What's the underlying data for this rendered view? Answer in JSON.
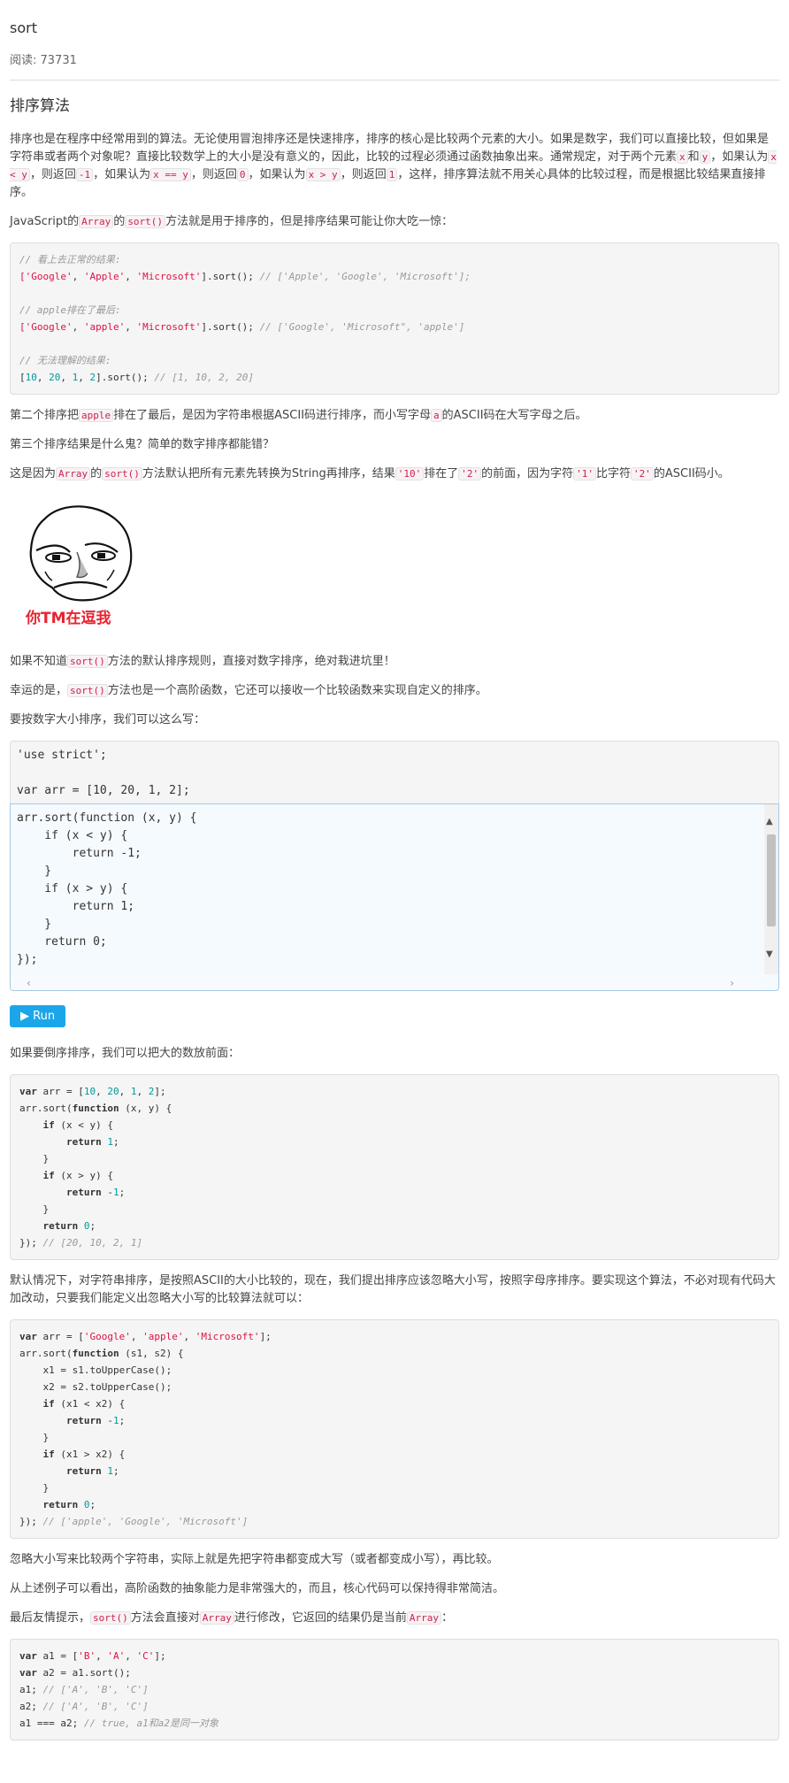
{
  "header": {
    "title": "sort",
    "reads_label": "阅读: 73731"
  },
  "article": {
    "heading": "排序算法",
    "intro_para": [
      "排序也是在程序中经常用到的算法。无论使用冒泡排序还是快速排序，排序的核心是比较两个元素的大小。如果是数字，我们可以直接比较，但如果是字符串或者两个对象呢？直接比较数学上的大小是没有意义的，因此，比较的过程必须通过函数抽象出来。通常规定，对于两个元素",
      "x",
      "和",
      "y",
      "，如果认为",
      "x < y",
      "，则返回",
      "-1",
      "，如果认为",
      "x == y",
      "，则返回",
      "0",
      "，如果认为",
      "x > y",
      "，则返回",
      "1",
      "，这样，排序算法就不用关心具体的比较过程，而是根据比较结果直接排序。"
    ],
    "js_para": [
      "JavaScript的",
      "Array",
      "的",
      "sort()",
      "方法就是用于排序的，但是排序结果可能让你大吃一惊："
    ],
    "code1": {
      "c1": "// 看上去正常的结果:",
      "l1a": "['Google'",
      "l1b": "'Apple'",
      "l1c": "'Microsoft'",
      "l1d": "].sort(); ",
      "l1e": "// ['Apple', 'Google', 'Microsoft'];",
      "c2": "// apple排在了最后:",
      "l2a": "['Google'",
      "l2b": "'apple'",
      "l2c": "'Microsoft'",
      "l2d": "].sort(); ",
      "l2e": "// ['Google', 'Microsoft\", 'apple']",
      "c3": "// 无法理解的结果:",
      "n1": "10",
      "n2": "20",
      "n3": "1",
      "n4": "2",
      "l3e": "// [1, 10, 2, 20]"
    },
    "p_second": [
      "第二个排序把",
      "apple",
      "排在了最后，是因为字符串根据ASCII码进行排序，而小写字母",
      "a",
      "的ASCII码在大写字母之后。"
    ],
    "p_third": "第三个排序结果是什么鬼？简单的数字排序都能错？",
    "p_because": [
      "这是因为",
      "Array",
      "的",
      "sort()",
      "方法默认把所有元素先转换为String再排序，结果",
      "'10'",
      "排在了",
      "'2'",
      "的前面，因为字符",
      "'1'",
      "比字符",
      "'2'",
      "的ASCII码小。"
    ],
    "meme_caption": "你TM在逗我",
    "p_if_not": [
      "如果不知道",
      "sort()",
      "方法的默认排序规则，直接对数字排序，绝对栽进坑里！"
    ],
    "p_luckily": [
      "幸运的是，",
      "sort()",
      "方法也是一个高阶函数，它还可以接收一个比较函数来实现自定义的排序。"
    ],
    "p_to_sort": "要按数字大小排序，我们可以这么写：",
    "static_code": "'use strict';\n\nvar arr = [10, 20, 1, 2];",
    "editor_code": "arr.sort(function (x, y) {\n    if (x < y) {\n        return -1;\n    }\n    if (x > y) {\n        return 1;\n    }\n    return 0;\n});",
    "run_label": "▶ Run",
    "p_reverse": "如果要倒序排序，我们可以把大的数放前面：",
    "p_default_case": "默认情况下，对字符串排序，是按照ASCII的大小比较的，现在，我们提出排序应该忽略大小写，按照字母序排序。要实现这个算法，不必对现有代码大加改动，只要我们能定义出忽略大小写的比较算法就可以：",
    "p_ignore": "忽略大小写来比较两个字符串，实际上就是先把字符串都变成大写（或者都变成小写），再比较。",
    "p_higher": "从上述例子可以看出，高阶函数的抽象能力是非常强大的，而且，核心代码可以保持得非常简洁。",
    "p_finally": [
      "最后友情提示，",
      "sort()",
      "方法会直接对",
      "Array",
      "进行修改，它返回的结果仍是当前",
      "Array",
      "："
    ]
  }
}
